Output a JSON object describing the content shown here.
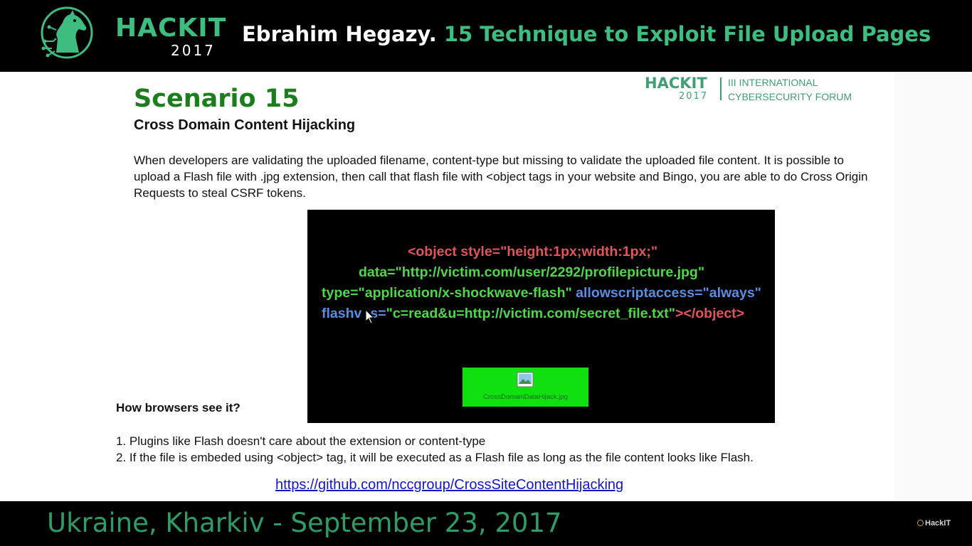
{
  "header": {
    "brand_name": "HACKIT",
    "brand_year": "2017",
    "speaker": "Ebrahim Hegazy.",
    "talk_title": "15 Technique to Exploit File Upload Pages",
    "logo_icon": "horse-head-circuit-icon"
  },
  "slide": {
    "logo": {
      "hackit": "HACKIT",
      "year": "2017",
      "forum_line1": "III INTERNATIONAL",
      "forum_line2": "CYBERSECURITY FORUM"
    },
    "title": "Scenario 15",
    "subtitle": "Cross Domain Content Hijacking",
    "intro": "When developers are validating the uploaded  filename, content-type but missing to validate the uploaded file content. It is possible to upload a Flash file with .jpg extension, then call that flash file with <object tags in your website and Bingo, you are able to do Cross Origin Requests to steal CSRF tokens.",
    "code": {
      "line1": "<object style=\"height:1px;width:1px;\"",
      "line2": "data=\"http://victim.com/user/2292/profilepicture.jpg\"",
      "line3_type": "type=\"application/x-shockwave-flash\"",
      "line3_allow": "allowscriptaccess=\"always\"",
      "line4_flashvars_a": "flashv",
      "line4_flashvars_b": "s=",
      "line4_value": "\"c=read&u=http://victim.com/secret_file.txt\"",
      "line4_close": "></object>",
      "file_name": "CrossDomainDataHijack.jpg",
      "colors": {
        "tag": "#e0545a",
        "string": "#4fd64a",
        "attribute": "#5a8de3",
        "thumbnail": "#10e010"
      }
    },
    "how_heading": "How browsers see it?",
    "points": [
      "1. Plugins like Flash doesn't care about the extension or content-type",
      "2. If the file is embeded using <object> tag, it will be executed as a Flash file as long as the file content looks like Flash."
    ],
    "link": "https://github.com/nccgroup/CrossSiteContentHijacking"
  },
  "footer": {
    "location": "Ukraine, Kharkiv - September 23, 2017",
    "watermark": "HackIT"
  }
}
